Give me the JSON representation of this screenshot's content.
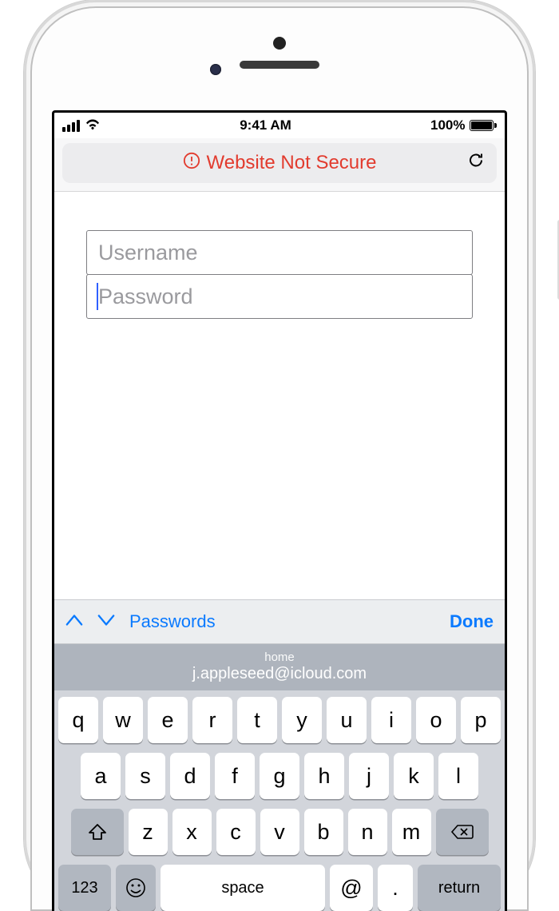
{
  "statusbar": {
    "time": "9:41 AM",
    "battery_pct": "100%"
  },
  "addressbar": {
    "warning_text": "Website Not Secure"
  },
  "form": {
    "username_placeholder": "Username",
    "password_placeholder": "Password"
  },
  "accessory": {
    "passwords_label": "Passwords",
    "done_label": "Done"
  },
  "autofill": {
    "label": "home",
    "value": "j.appleseed@icloud.com"
  },
  "keyboard": {
    "row1": [
      "q",
      "w",
      "e",
      "r",
      "t",
      "y",
      "u",
      "i",
      "o",
      "p"
    ],
    "row2": [
      "a",
      "s",
      "d",
      "f",
      "g",
      "h",
      "j",
      "k",
      "l"
    ],
    "row3": [
      "z",
      "x",
      "c",
      "v",
      "b",
      "n",
      "m"
    ],
    "numkey": "123",
    "space": "space",
    "at": "@",
    "dot": ".",
    "return": "return"
  }
}
